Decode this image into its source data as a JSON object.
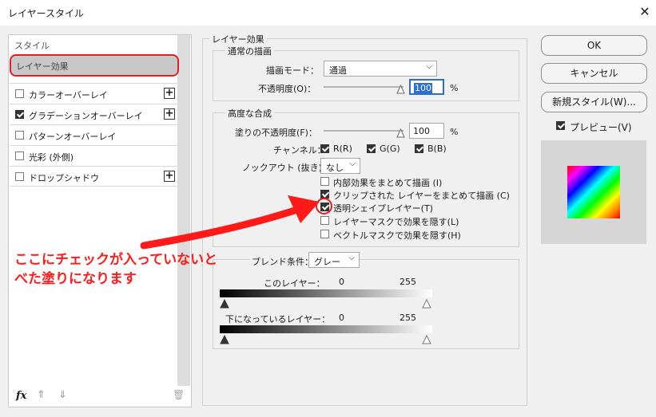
{
  "window": {
    "title": "レイヤースタイル"
  },
  "left": {
    "header": "スタイル",
    "selected": "レイヤー効果",
    "items": [
      {
        "label": "カラーオーバーレイ",
        "checked": false,
        "plus": true
      },
      {
        "label": "グラデーションオーバーレイ",
        "checked": true,
        "plus": true
      },
      {
        "label": "パターンオーバーレイ",
        "checked": false,
        "plus": false
      },
      {
        "label": "光彩 (外側)",
        "checked": false,
        "plus": false
      },
      {
        "label": "ドロップシャドウ",
        "checked": false,
        "plus": true
      }
    ],
    "footer": {
      "fx": "fx",
      "up": "⇑",
      "down": "⇓",
      "trash": "🗑"
    }
  },
  "main": {
    "section_title": "レイヤー効果",
    "normal": {
      "title": "通常の描画",
      "mode_label": "描画モード：",
      "mode_value": "通過",
      "opacity_label": "不透明度(O)：",
      "opacity_value": "100",
      "percent": "%"
    },
    "advanced": {
      "title": "高度な合成",
      "fill_label": "塗りの不透明度(F)：",
      "fill_value": "100",
      "percent": "%",
      "channel_label": "チャンネル：",
      "channels": [
        "R(R)",
        "G(G)",
        "B(B)"
      ],
      "knockout_label": "ノックアウト (抜き)：",
      "knockout_value": "なし",
      "options": [
        {
          "label": "内部効果をまとめて描画 (I)",
          "checked": false
        },
        {
          "label": "クリップされた レイヤーをまとめて描画 (C)",
          "checked": true
        },
        {
          "label": "透明シェイプレイヤー(T)",
          "checked": true
        },
        {
          "label": "レイヤーマスクで効果を隠す(L)",
          "checked": false
        },
        {
          "label": "ベクトルマスクで効果を隠す(H)",
          "checked": false
        }
      ]
    },
    "blend": {
      "label": "ブレンド条件：",
      "value": "グレー",
      "this_layer": "このレイヤー：",
      "under_layer": "下になっているレイヤー：",
      "min": "0",
      "max": "255"
    }
  },
  "buttons": {
    "ok": "OK",
    "cancel": "キャンセル",
    "new_style": "新規スタイル(W)...",
    "preview_label": "プレビュー(V)"
  },
  "annotation": {
    "line1": "ここにチェックが入っていないと",
    "line2": "べた塗りになります",
    "color": "#ff1a1a"
  }
}
